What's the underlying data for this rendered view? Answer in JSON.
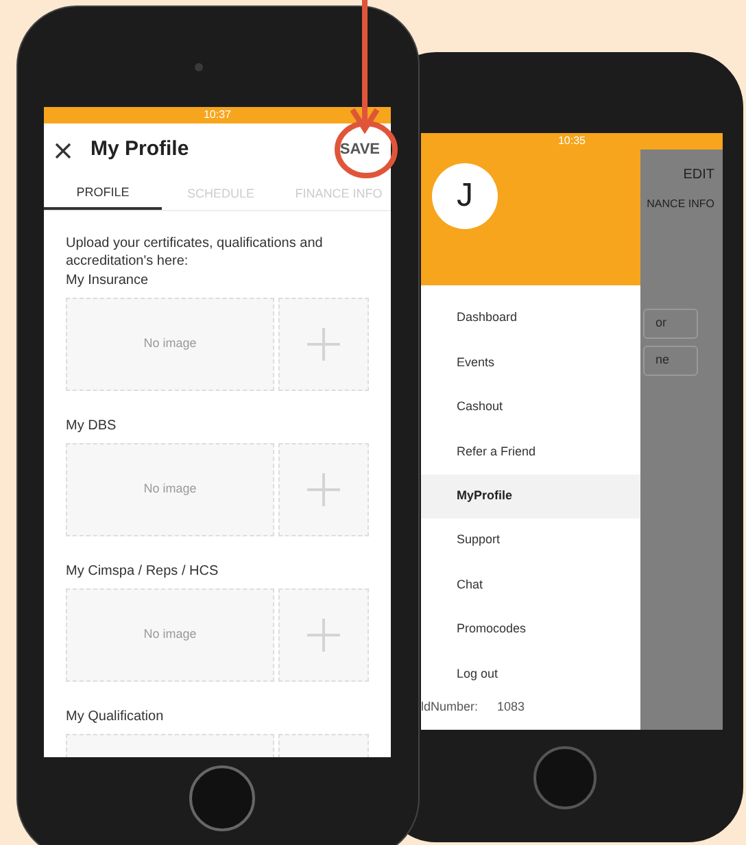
{
  "left_screen": {
    "status_bar": {
      "time": "10:37"
    },
    "title": "My Profile",
    "save_button": "SAVE",
    "tabs": [
      {
        "label": "PROFILE",
        "selected": true
      },
      {
        "label": "SCHEDULE",
        "selected": false
      },
      {
        "label": "FINANCE INFO",
        "selected": false
      }
    ],
    "intro": "Upload your certificates, qualifications and accreditation's here:",
    "sections": [
      {
        "label": "My Insurance",
        "placeholder": "No image"
      },
      {
        "label": "My DBS",
        "placeholder": "No image"
      },
      {
        "label": "My Cimspa / Reps / HCS",
        "placeholder": "No image"
      },
      {
        "label": "My Qualification"
      }
    ]
  },
  "right_screen": {
    "status_bar": {
      "time": "10:35"
    },
    "avatar": "J",
    "edit_button": "EDIT",
    "tab": "NANCE INFO",
    "fields": [
      "or",
      "ne"
    ],
    "menu": [
      {
        "label": "Dashboard",
        "selected": false
      },
      {
        "label": "Events",
        "selected": false
      },
      {
        "label": "Cashout",
        "selected": false
      },
      {
        "label": "Refer a Friend",
        "selected": false
      },
      {
        "label": "MyProfile",
        "selected": true
      },
      {
        "label": "Support",
        "selected": false
      },
      {
        "label": "Chat",
        "selected": false
      },
      {
        "label": "Promocodes",
        "selected": false
      },
      {
        "label": "Log out",
        "selected": false
      }
    ],
    "build_label": "ldNumber:",
    "build_value": "1083"
  }
}
